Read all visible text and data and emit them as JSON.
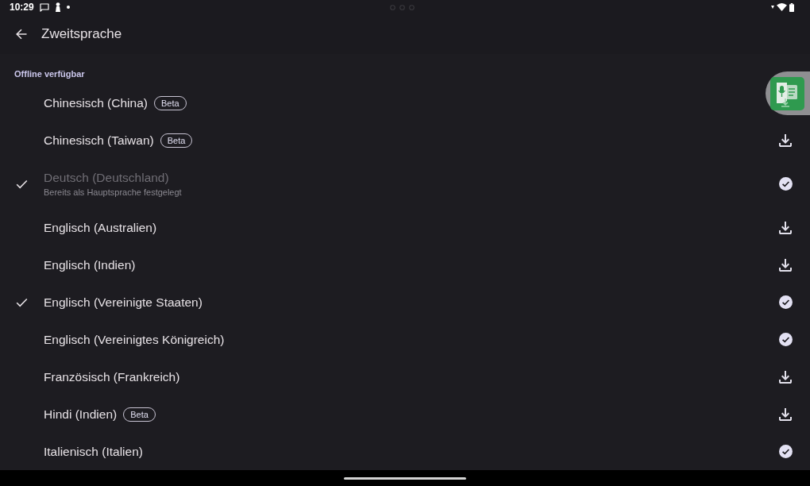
{
  "status_bar": {
    "time": "10:29"
  },
  "app_bar": {
    "title": "Zweitsprache"
  },
  "section": {
    "header": "Offline verfügbar"
  },
  "languages": [
    {
      "name": "Chinesisch (China)",
      "badge": "Beta",
      "selected": false,
      "disabled": false
    },
    {
      "name": "Chinesisch (Taiwan)",
      "badge": "Beta",
      "selected": false,
      "disabled": false,
      "downloaded": false
    },
    {
      "name": "Deutsch (Deutschland)",
      "subtitle": "Bereits als Hauptsprache festgelegt",
      "selected": true,
      "disabled": true,
      "downloaded": true
    },
    {
      "name": "Englisch (Australien)",
      "selected": false,
      "disabled": false,
      "downloaded": false
    },
    {
      "name": "Englisch (Indien)",
      "selected": false,
      "disabled": false,
      "downloaded": false
    },
    {
      "name": "Englisch (Vereinigte Staaten)",
      "selected": true,
      "disabled": false,
      "downloaded": true
    },
    {
      "name": "Englisch (Vereinigtes Königreich)",
      "selected": false,
      "disabled": false,
      "downloaded": true
    },
    {
      "name": "Französisch (Frankreich)",
      "selected": false,
      "disabled": false,
      "downloaded": false
    },
    {
      "name": "Hindi (Indien)",
      "badge": "Beta",
      "selected": false,
      "disabled": false,
      "downloaded": false
    },
    {
      "name": "Italienisch (Italien)",
      "selected": false,
      "disabled": false,
      "downloaded": true
    }
  ]
}
